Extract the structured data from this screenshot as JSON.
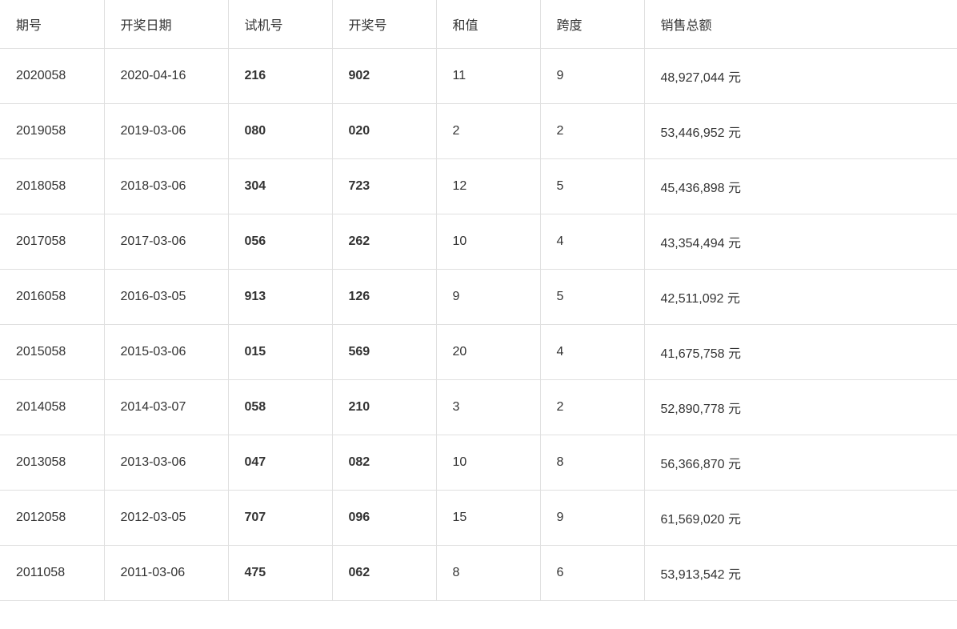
{
  "table": {
    "headers": [
      "期号",
      "开奖日期",
      "试机号",
      "开奖号",
      "和值",
      "跨度",
      "销售总额"
    ],
    "rows": [
      {
        "qihao": "2020058",
        "date": "2020-04-16",
        "shiji": "216",
        "kaijang": "902",
        "hezhi": "11",
        "kuadu": "9",
        "xiaoshou": "48,927,044 元"
      },
      {
        "qihao": "2019058",
        "date": "2019-03-06",
        "shiji": "080",
        "kaijang": "020",
        "hezhi": "2",
        "kuadu": "2",
        "xiaoshou": "53,446,952 元"
      },
      {
        "qihao": "2018058",
        "date": "2018-03-06",
        "shiji": "304",
        "kaijang": "723",
        "hezhi": "12",
        "kuadu": "5",
        "xiaoshou": "45,436,898 元"
      },
      {
        "qihao": "2017058",
        "date": "2017-03-06",
        "shiji": "056",
        "kaijang": "262",
        "hezhi": "10",
        "kuadu": "4",
        "xiaoshou": "43,354,494 元"
      },
      {
        "qihao": "2016058",
        "date": "2016-03-05",
        "shiji": "913",
        "kaijang": "126",
        "hezhi": "9",
        "kuadu": "5",
        "xiaoshou": "42,511,092 元"
      },
      {
        "qihao": "2015058",
        "date": "2015-03-06",
        "shiji": "015",
        "kaijang": "569",
        "hezhi": "20",
        "kuadu": "4",
        "xiaoshou": "41,675,758 元"
      },
      {
        "qihao": "2014058",
        "date": "2014-03-07",
        "shiji": "058",
        "kaijang": "210",
        "hezhi": "3",
        "kuadu": "2",
        "xiaoshou": "52,890,778 元"
      },
      {
        "qihao": "2013058",
        "date": "2013-03-06",
        "shiji": "047",
        "kaijang": "082",
        "hezhi": "10",
        "kuadu": "8",
        "xiaoshou": "56,366,870 元"
      },
      {
        "qihao": "2012058",
        "date": "2012-03-05",
        "shiji": "707",
        "kaijang": "096",
        "hezhi": "15",
        "kuadu": "9",
        "xiaoshou": "61,569,020 元"
      },
      {
        "qihao": "2011058",
        "date": "2011-03-06",
        "shiji": "475",
        "kaijang": "062",
        "hezhi": "8",
        "kuadu": "6",
        "xiaoshou": "53,913,542 元"
      }
    ]
  }
}
